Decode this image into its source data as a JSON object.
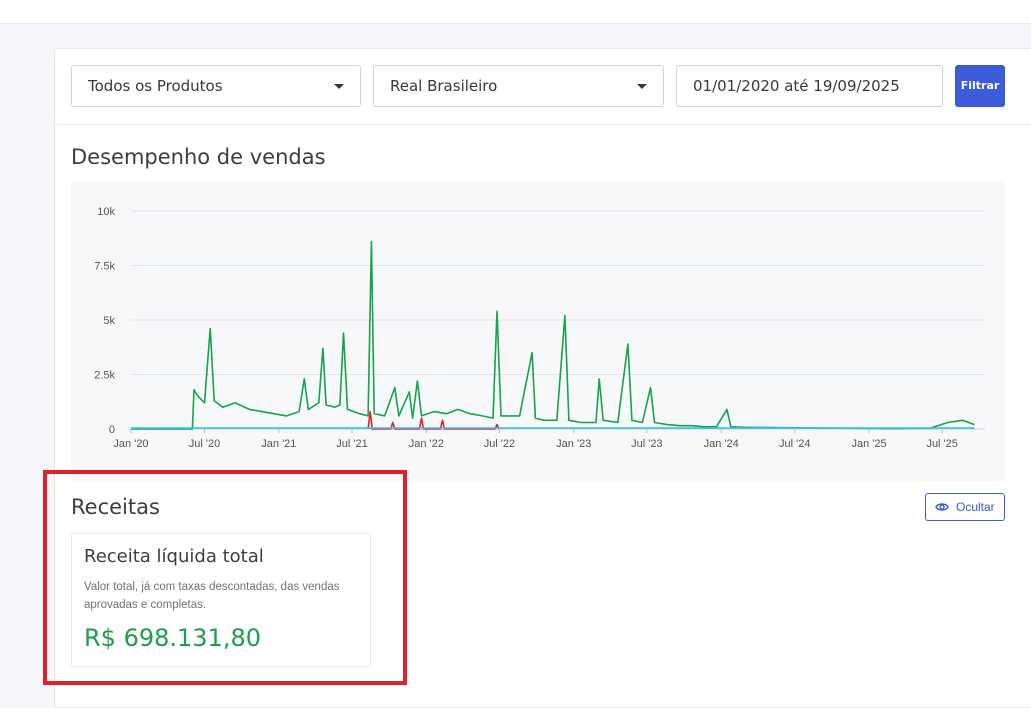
{
  "filters": {
    "product": "Todos os Produtos",
    "currency": "Real Brasileiro",
    "date_range": "01/01/2020 até 19/09/2025",
    "filter_button": "Filtrar"
  },
  "sales_section": {
    "title": "Desempenho de vendas"
  },
  "chart_data": {
    "type": "line",
    "title": "",
    "xlabel": "",
    "ylabel": "",
    "ylim": [
      0,
      10000
    ],
    "y_ticks": [
      "0",
      "2.5k",
      "5k",
      "7.5k",
      "10k"
    ],
    "x_ticks": [
      "Jan '20",
      "Jul '20",
      "Jan '21",
      "Jul '21",
      "Jan '22",
      "Jul '22",
      "Jan '23",
      "Jul '23",
      "Jan '24",
      "Jul '24",
      "Jan '25",
      "Jul '25"
    ],
    "grid": true,
    "series": [
      {
        "color": "#16a34a",
        "points": [
          [
            "2020-01-01",
            0
          ],
          [
            "2020-06-01",
            0
          ],
          [
            "2020-06-05",
            1800
          ],
          [
            "2020-06-15",
            1500
          ],
          [
            "2020-07-01",
            1200
          ],
          [
            "2020-07-15",
            4600
          ],
          [
            "2020-07-25",
            1300
          ],
          [
            "2020-08-15",
            1000
          ],
          [
            "2020-09-15",
            1200
          ],
          [
            "2020-10-20",
            900
          ],
          [
            "2020-11-20",
            800
          ],
          [
            "2020-12-20",
            700
          ],
          [
            "2021-01-20",
            600
          ],
          [
            "2021-02-20",
            800
          ],
          [
            "2021-03-05",
            2300
          ],
          [
            "2021-03-15",
            900
          ],
          [
            "2021-04-10",
            1200
          ],
          [
            "2021-04-20",
            3700
          ],
          [
            "2021-04-28",
            1100
          ],
          [
            "2021-05-20",
            1000
          ],
          [
            "2021-06-01",
            1100
          ],
          [
            "2021-06-10",
            4400
          ],
          [
            "2021-06-20",
            900
          ],
          [
            "2021-07-20",
            700
          ],
          [
            "2021-08-10",
            600
          ],
          [
            "2021-08-18",
            8600
          ],
          [
            "2021-08-25",
            700
          ],
          [
            "2021-09-20",
            600
          ],
          [
            "2021-10-15",
            1900
          ],
          [
            "2021-10-25",
            600
          ],
          [
            "2021-11-20",
            1700
          ],
          [
            "2021-11-28",
            500
          ],
          [
            "2021-12-10",
            2200
          ],
          [
            "2021-12-20",
            600
          ],
          [
            "2022-01-20",
            800
          ],
          [
            "2022-02-20",
            700
          ],
          [
            "2022-03-20",
            900
          ],
          [
            "2022-04-20",
            700
          ],
          [
            "2022-05-20",
            600
          ],
          [
            "2022-06-15",
            500
          ],
          [
            "2022-06-25",
            5400
          ],
          [
            "2022-07-05",
            600
          ],
          [
            "2022-08-20",
            600
          ],
          [
            "2022-09-20",
            3500
          ],
          [
            "2022-09-28",
            500
          ],
          [
            "2022-10-20",
            400
          ],
          [
            "2022-11-20",
            400
          ],
          [
            "2022-12-10",
            5200
          ],
          [
            "2022-12-20",
            400
          ],
          [
            "2023-01-20",
            300
          ],
          [
            "2023-02-25",
            300
          ],
          [
            "2023-03-05",
            2300
          ],
          [
            "2023-03-15",
            400
          ],
          [
            "2023-04-20",
            300
          ],
          [
            "2023-05-15",
            3900
          ],
          [
            "2023-05-25",
            400
          ],
          [
            "2023-06-20",
            300
          ],
          [
            "2023-07-10",
            1900
          ],
          [
            "2023-07-20",
            300
          ],
          [
            "2023-08-20",
            200
          ],
          [
            "2023-09-20",
            150
          ],
          [
            "2023-10-20",
            150
          ],
          [
            "2023-11-20",
            100
          ],
          [
            "2023-12-20",
            100
          ],
          [
            "2024-01-15",
            900
          ],
          [
            "2024-01-25",
            100
          ],
          [
            "2024-03-01",
            80
          ],
          [
            "2024-06-01",
            60
          ],
          [
            "2024-09-01",
            40
          ],
          [
            "2024-12-01",
            30
          ],
          [
            "2025-03-01",
            20
          ],
          [
            "2025-06-01",
            30
          ],
          [
            "2025-07-15",
            300
          ],
          [
            "2025-08-20",
            400
          ],
          [
            "2025-09-19",
            200
          ]
        ]
      },
      {
        "color": "#dc2626",
        "points": [
          [
            "2021-08-10",
            0
          ],
          [
            "2021-08-15",
            800
          ],
          [
            "2021-08-20",
            0
          ],
          [
            "2021-10-05",
            0
          ],
          [
            "2021-10-10",
            300
          ],
          [
            "2021-10-15",
            0
          ],
          [
            "2021-12-15",
            0
          ],
          [
            "2021-12-20",
            500
          ],
          [
            "2021-12-25",
            0
          ],
          [
            "2022-02-05",
            0
          ],
          [
            "2022-02-10",
            400
          ],
          [
            "2022-02-15",
            0
          ],
          [
            "2022-06-20",
            0
          ],
          [
            "2022-06-25",
            200
          ],
          [
            "2022-06-30",
            0
          ]
        ]
      },
      {
        "color": "#38bdf8",
        "points": [
          [
            "2020-01-01",
            40
          ],
          [
            "2025-09-19",
            40
          ]
        ]
      }
    ]
  },
  "revenue_section": {
    "title": "Receitas",
    "hide_button": "Ocultar",
    "card": {
      "title": "Receita líquida total",
      "description": "Valor total, já com taxas descontadas, das vendas aprovadas e completas.",
      "value": "R$ 698.131,80",
      "value_color": "#1e9e4a"
    }
  }
}
